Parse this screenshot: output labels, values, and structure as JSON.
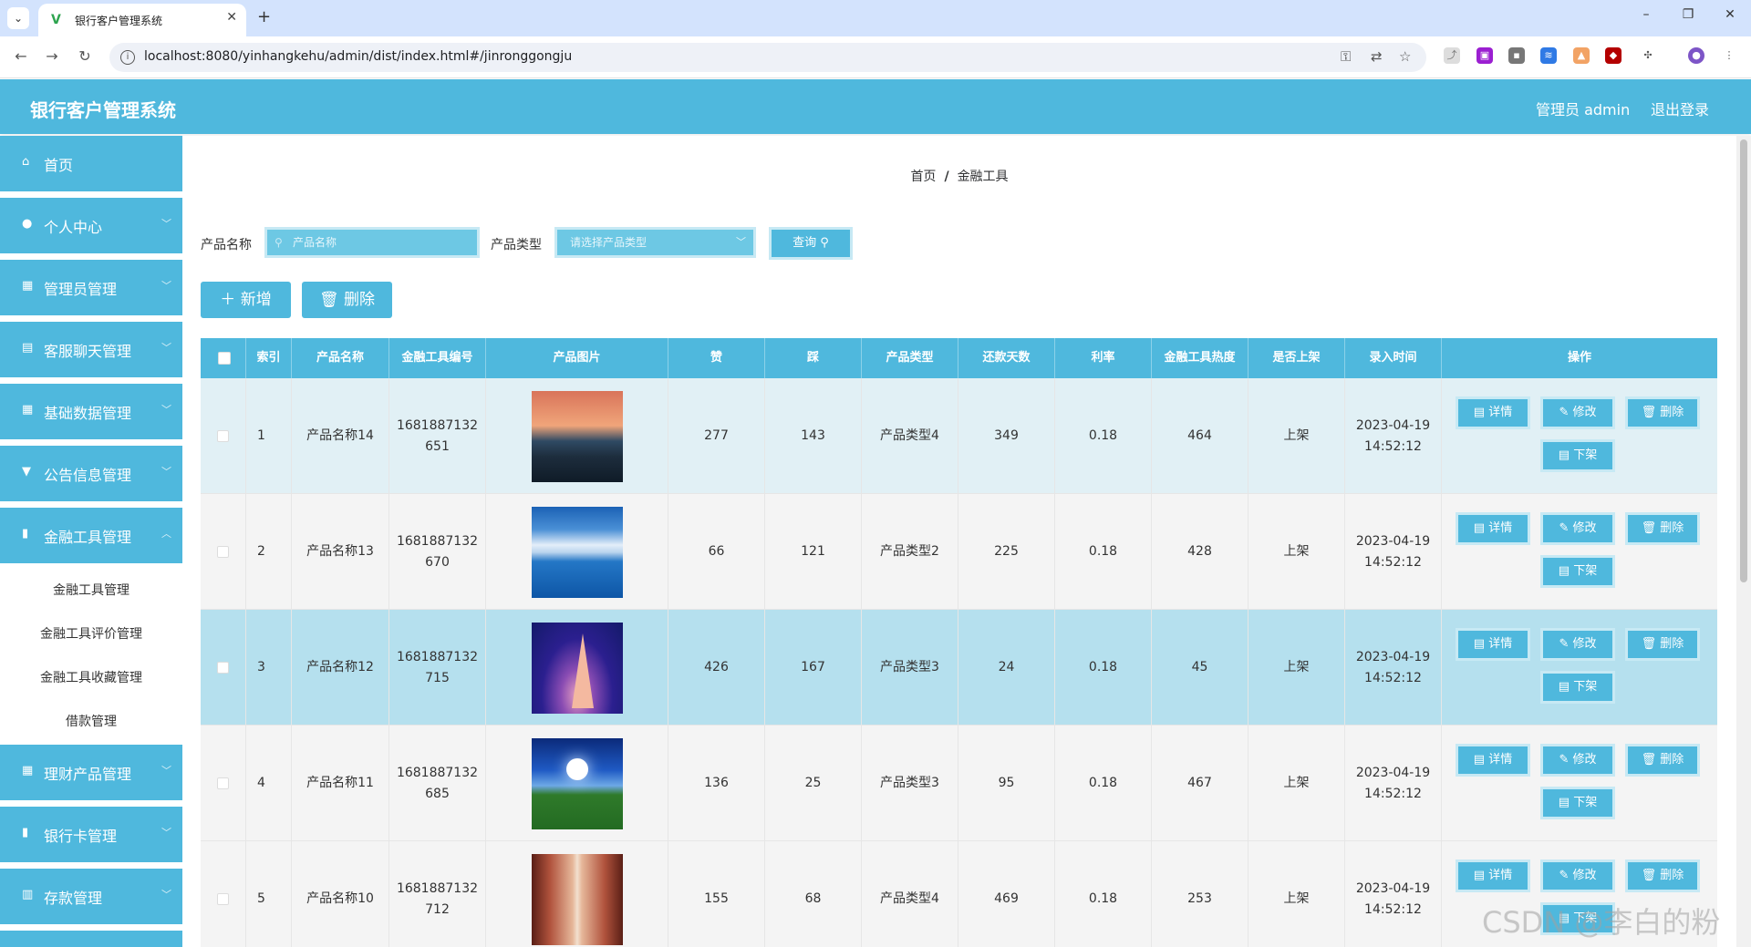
{
  "browser": {
    "tab_title": "银行客户管理系统",
    "url": "localhost:8080/yinhangkehu/admin/dist/index.html#/jinronggongju",
    "new_tab_symbol": "+",
    "close_symbol": "✕",
    "window_controls": [
      "–",
      "❐",
      "✕"
    ]
  },
  "header": {
    "app_title": "银行客户管理系统",
    "user_label": "管理员 admin",
    "logout_label": "退出登录"
  },
  "sidebar": {
    "items": [
      {
        "label": "首页",
        "icon": "home-icon",
        "glyph": "⌂",
        "arrow": ""
      },
      {
        "label": "个人中心",
        "icon": "user-icon",
        "glyph": "●",
        "arrow": "﹀"
      },
      {
        "label": "管理员管理",
        "icon": "grid-icon",
        "glyph": "▦",
        "arrow": "﹀"
      },
      {
        "label": "客服聊天管理",
        "icon": "chat-icon",
        "glyph": "▤",
        "arrow": "﹀"
      },
      {
        "label": "基础数据管理",
        "icon": "grid-icon",
        "glyph": "▦",
        "arrow": "﹀"
      },
      {
        "label": "公告信息管理",
        "icon": "notice-icon",
        "glyph": "▼",
        "arrow": "﹀"
      },
      {
        "label": "金融工具管理",
        "icon": "document-icon",
        "glyph": "▮",
        "arrow": "︿"
      }
    ],
    "subitems": [
      "金融工具管理",
      "金融工具评价管理",
      "金融工具收藏管理",
      "借款管理"
    ],
    "items_after": [
      {
        "label": "理财产品管理",
        "icon": "grid-icon",
        "glyph": "▦",
        "arrow": "﹀"
      },
      {
        "label": "银行卡管理",
        "icon": "card-icon",
        "glyph": "▮",
        "arrow": "﹀"
      },
      {
        "label": "存款管理",
        "icon": "chart-icon",
        "glyph": "▥",
        "arrow": "﹀"
      }
    ]
  },
  "breadcrumb": {
    "home": "首页",
    "separator": "/",
    "current": "金融工具"
  },
  "search": {
    "name_label": "产品名称",
    "name_placeholder": "产品名称",
    "type_label": "产品类型",
    "type_placeholder": "请选择产品类型",
    "query_label": "查询 ⚲"
  },
  "actions": {
    "add_label": "＋ 新增",
    "delete_label": "🗑 删除"
  },
  "table": {
    "headers": [
      "索引",
      "产品名称",
      "金融工具编号",
      "产品图片",
      "赞",
      "踩",
      "产品类型",
      "还款天数",
      "利率",
      "金融工具热度",
      "是否上架",
      "录入时间",
      "操作"
    ],
    "op_labels": {
      "detail": "▤ 详情",
      "edit": "✎ 修改",
      "delete": "🗑 删除",
      "offshelf": "▤ 下架"
    },
    "rows": [
      {
        "index": "1",
        "name": "产品名称14",
        "code_1": "1681887132",
        "code_2": "651",
        "likes": "277",
        "dislikes": "143",
        "type": "产品类型4",
        "days": "349",
        "rate": "0.18",
        "heat": "464",
        "onshelf": "上架",
        "date": "2023-04-19",
        "time": "14:52:12"
      },
      {
        "index": "2",
        "name": "产品名称13",
        "code_1": "1681887132",
        "code_2": "670",
        "likes": "66",
        "dislikes": "121",
        "type": "产品类型2",
        "days": "225",
        "rate": "0.18",
        "heat": "428",
        "onshelf": "上架",
        "date": "2023-04-19",
        "time": "14:52:12"
      },
      {
        "index": "3",
        "name": "产品名称12",
        "code_1": "1681887132",
        "code_2": "715",
        "likes": "426",
        "dislikes": "167",
        "type": "产品类型3",
        "days": "24",
        "rate": "0.18",
        "heat": "45",
        "onshelf": "上架",
        "date": "2023-04-19",
        "time": "14:52:12"
      },
      {
        "index": "4",
        "name": "产品名称11",
        "code_1": "1681887132",
        "code_2": "685",
        "likes": "136",
        "dislikes": "25",
        "type": "产品类型3",
        "days": "95",
        "rate": "0.18",
        "heat": "467",
        "onshelf": "上架",
        "date": "2023-04-19",
        "time": "14:52:12"
      },
      {
        "index": "5",
        "name": "产品名称10",
        "code_1": "1681887132",
        "code_2": "712",
        "likes": "155",
        "dislikes": "68",
        "type": "产品类型4",
        "days": "469",
        "rate": "0.18",
        "heat": "253",
        "onshelf": "上架",
        "date": "2023-04-19",
        "time": "14:52:12"
      }
    ]
  },
  "watermark": "CSDN @李白的粉"
}
